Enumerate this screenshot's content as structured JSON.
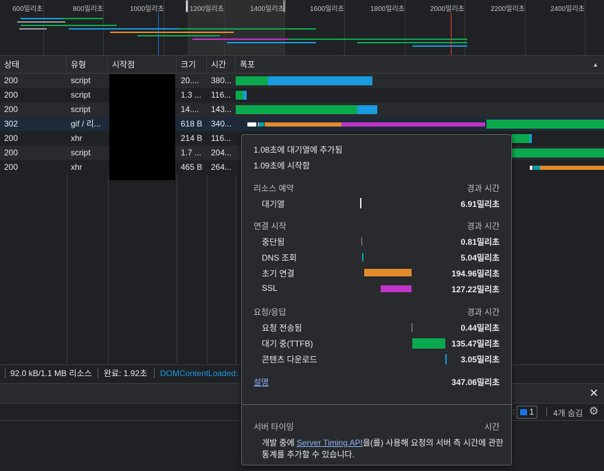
{
  "overview": {
    "ticks": [
      "600밀리초",
      "800밀리초",
      "1000밀리초",
      "1200밀리초",
      "1400밀리초",
      "1600밀리초",
      "1800밀리초",
      "2000밀리초",
      "2200밀리초",
      "2400밀리초"
    ]
  },
  "table": {
    "columns": {
      "status": "상태",
      "type": "유형",
      "initiator": "시작점",
      "size": "크기",
      "time": "시간",
      "waterfall": "폭포"
    },
    "sort_icon": "triangle-up-icon",
    "rows": [
      {
        "status": "200",
        "type": "script",
        "size": "20....",
        "time": "380..."
      },
      {
        "status": "200",
        "type": "script",
        "size": "1.3 ...",
        "time": "116..."
      },
      {
        "status": "200",
        "type": "script",
        "size": "14....",
        "time": "143..."
      },
      {
        "status": "302",
        "type": "gif / 리...",
        "size": "618 B",
        "time": "340..."
      },
      {
        "status": "200",
        "type": "xhr",
        "size": "214 B",
        "time": "116..."
      },
      {
        "status": "200",
        "type": "script",
        "size": "1.7 ...",
        "time": "204..."
      },
      {
        "status": "200",
        "type": "xhr",
        "size": "465 B",
        "time": "264..."
      }
    ]
  },
  "statusbar": {
    "transferred": "92.0 kB/1.1 MB 리소스",
    "finish": "완료: 1.92초",
    "dcl": "DOMContentLoaded:"
  },
  "drawer": {
    "issues_count": "1",
    "hidden": "4개 숨김",
    "close_icon": "close-icon",
    "settings_icon": "gear-icon"
  },
  "tooltip": {
    "queued": "1.08초에 대기열에 추가됨",
    "started": "1.09초에 시작함",
    "resource_scheduling": {
      "title": "리소스 예약",
      "dur_label": "경과 시간",
      "items": [
        {
          "label": "대기열",
          "value": "6.91밀리초"
        }
      ]
    },
    "connection_start": {
      "title": "연결 시작",
      "dur_label": "경과 시간",
      "items": [
        {
          "label": "중단됨",
          "value": "0.81밀리초"
        },
        {
          "label": "DNS 조회",
          "value": "5.04밀리초"
        },
        {
          "label": "초기 연결",
          "value": "194.96밀리초"
        },
        {
          "label": "SSL",
          "value": "127.22밀리초"
        }
      ]
    },
    "request_response": {
      "title": "요청/응답",
      "dur_label": "경과 시간",
      "items": [
        {
          "label": "요청 전송됨",
          "value": "0.44밀리초"
        },
        {
          "label": "대기 중(TTFB)",
          "value": "135.47밀리초"
        },
        {
          "label": "콘텐츠 다운로드",
          "value": "3.05밀리초"
        }
      ]
    },
    "explanation": "설명",
    "total": "347.06밀리초",
    "server_timing": {
      "title": "서버 타이밍",
      "time_label": "시간",
      "text_before": "개발 중에 ",
      "link": "Server Timing API",
      "text_after": "을(를) 사용해 요청의 서버 측 시간에 관한",
      "line2": "통계를 추가할 수 있습니다."
    }
  },
  "colors": {
    "queue": "#ffffff",
    "stalled": "#9aa0a6",
    "dns": "#00a6a6",
    "connect": "#e38b2b",
    "ssl": "#c034c8",
    "ttfb": "#0ba94e",
    "download": "#1a9ae0",
    "link": "#8ab4f8"
  }
}
